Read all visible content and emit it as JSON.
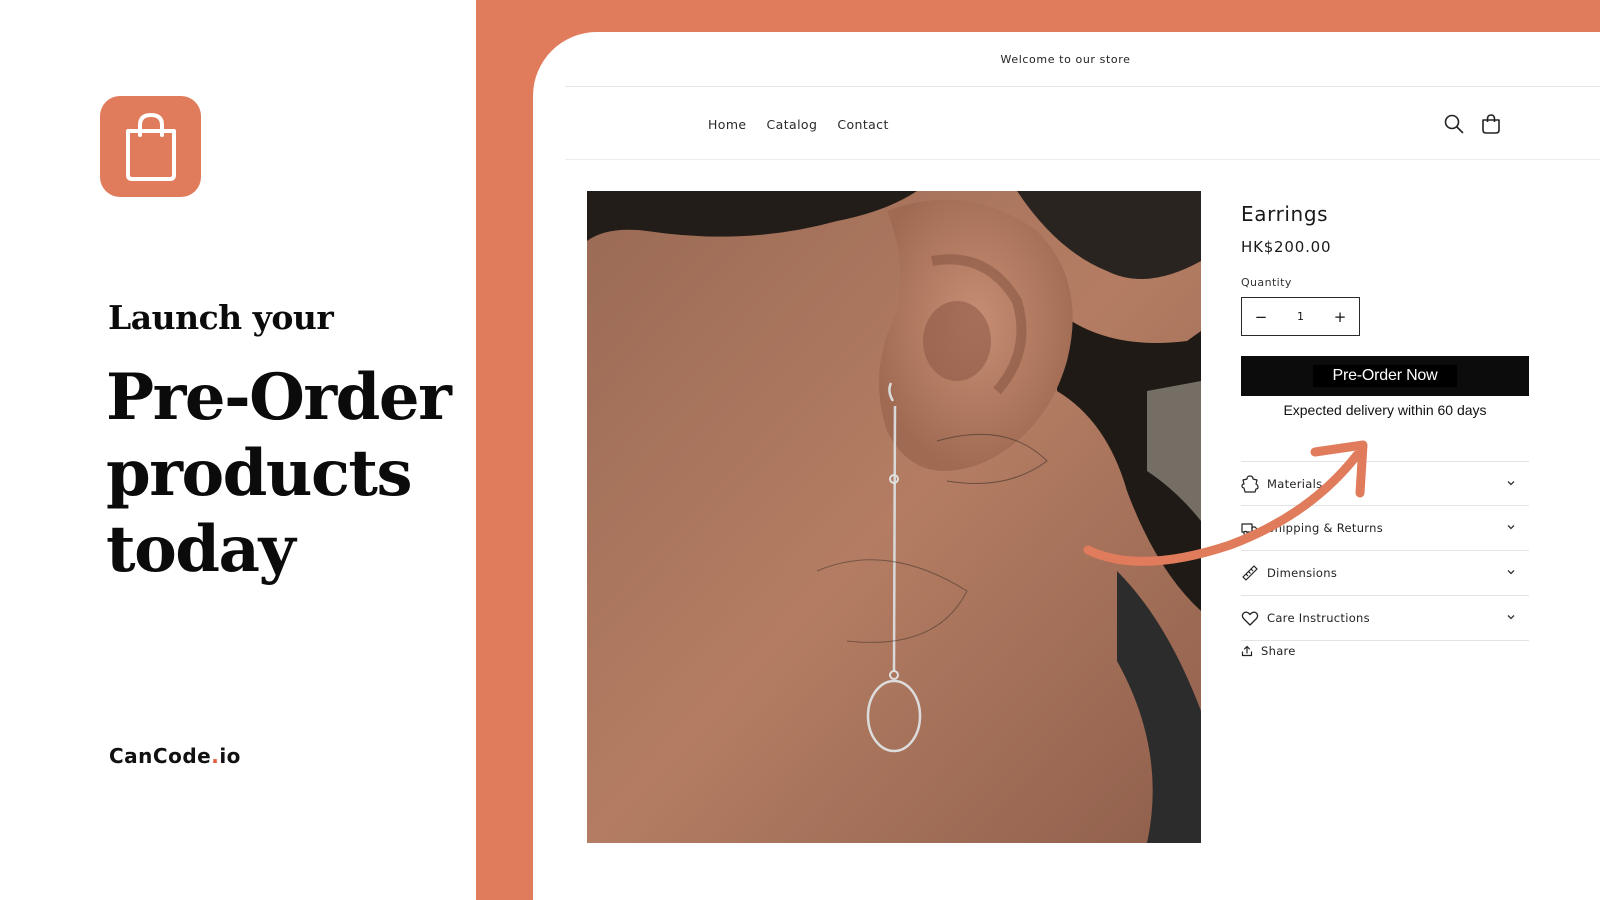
{
  "promo": {
    "headline_small": "Launch your",
    "headline_lines": [
      "Pre-Order",
      "products",
      "today"
    ],
    "brand_main": "CanCode",
    "brand_dot": ".",
    "brand_suffix": "io",
    "icon": "shopping-bag-icon"
  },
  "store": {
    "announcement": "Welcome to our store",
    "nav": [
      "Home",
      "Catalog",
      "Contact"
    ],
    "icons": [
      "search-icon",
      "cart-icon"
    ],
    "product": {
      "title": "Earrings",
      "price": "HK$200.00",
      "quantity_label": "Quantity",
      "quantity_value": "1",
      "decrease": "−",
      "increase": "+",
      "preorder_label": "Pre-Order Now",
      "delivery_note": "Expected delivery within 60 days"
    },
    "accordion": [
      {
        "label": "Materials",
        "icon": "puzzle-icon"
      },
      {
        "label": "Shipping & Returns",
        "icon": "truck-icon"
      },
      {
        "label": "Dimensions",
        "icon": "ruler-icon"
      },
      {
        "label": "Care Instructions",
        "icon": "heart-icon"
      }
    ],
    "share_label": "Share"
  },
  "colors": {
    "accent": "#e07c5c",
    "button_bg": "#0c0c0c",
    "brand_dot": "#e85a3b"
  }
}
